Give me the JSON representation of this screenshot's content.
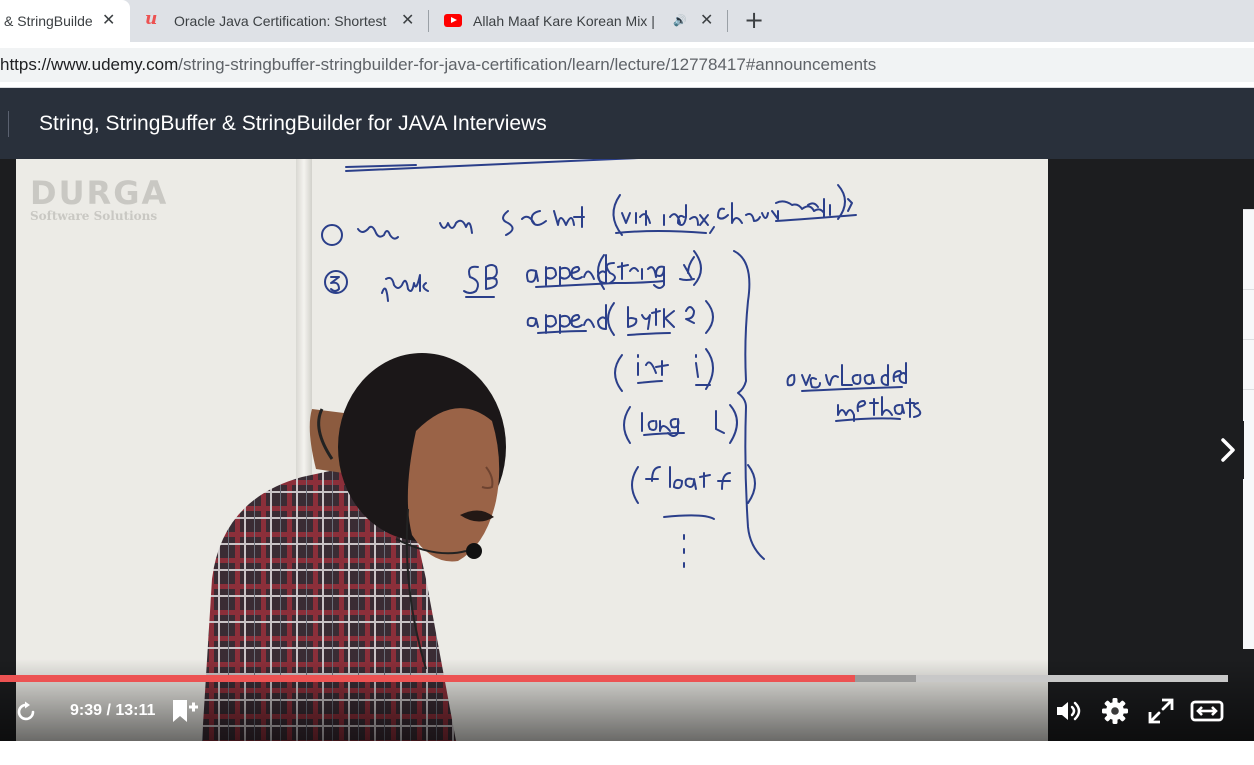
{
  "browser": {
    "tabs": [
      {
        "title": "& StringBuilder for JAVA Interviews",
        "active": true
      },
      {
        "title": "Oracle Java Certification: Shortest",
        "favicon": "udemy-icon",
        "active": false
      },
      {
        "title": "Allah Maaf Kare Korean Mix | ",
        "favicon": "youtube-icon",
        "audio": "speaker-icon",
        "active": false
      }
    ],
    "url_host": "https://www.udemy.com",
    "url_path": "/string-stringbuffer-stringbuilder-for-java-certification/learn/lecture/12778417#announcements"
  },
  "course": {
    "title": "String, StringBuffer & StringBuilder for JAVA Interviews"
  },
  "video": {
    "watermark_brand": "DURGA",
    "watermark_sub": "Software Solutions",
    "time": "9:39 / 13:11",
    "played_fraction": 0.696,
    "buffered_fraction": 0.746
  },
  "colors": {
    "header_bg": "#29303b",
    "progress_played": "#ec5252",
    "player_bg": "#1c1d1f"
  }
}
